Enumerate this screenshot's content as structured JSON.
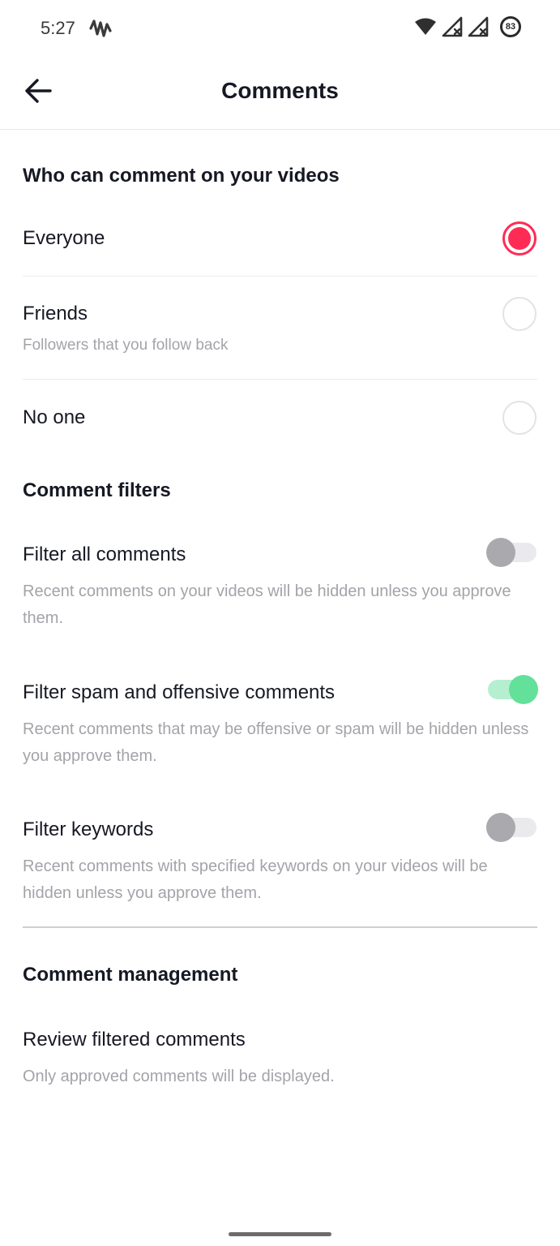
{
  "status_bar": {
    "time": "5:27",
    "battery_level": "83"
  },
  "header": {
    "title": "Comments"
  },
  "who_can_comment": {
    "title": "Who can comment on your videos",
    "options": [
      {
        "label": "Everyone",
        "sublabel": "",
        "selected": true
      },
      {
        "label": "Friends",
        "sublabel": "Followers that you follow back",
        "selected": false
      },
      {
        "label": "No one",
        "sublabel": "",
        "selected": false
      }
    ]
  },
  "comment_filters": {
    "title": "Comment filters",
    "items": [
      {
        "label": "Filter all comments",
        "description": "Recent comments on your videos will be hidden unless you approve them.",
        "enabled": false
      },
      {
        "label": "Filter spam and offensive comments",
        "description": "Recent comments that may be offensive or spam will be hidden unless you approve them.",
        "enabled": true
      },
      {
        "label": "Filter keywords",
        "description": "Recent comments with specified keywords on your videos will be hidden unless you approve them.",
        "enabled": false
      }
    ]
  },
  "comment_management": {
    "title": "Comment management",
    "item": {
      "label": "Review filtered comments",
      "description": "Only approved comments will be displayed."
    }
  },
  "colors": {
    "accent_radio": "#fe2c55",
    "toggle_on": "#63e09a",
    "toggle_off": "#a9a9ae",
    "text_primary": "#161823",
    "text_secondary": "#a3a4a9"
  },
  "icons": {
    "back": "arrow-left-icon",
    "app_notification": "waveform-icon",
    "wifi": "wifi-icon",
    "signal_1": "signal-no-service-icon",
    "signal_2": "signal-no-service-icon",
    "battery": "battery-ring-icon"
  }
}
